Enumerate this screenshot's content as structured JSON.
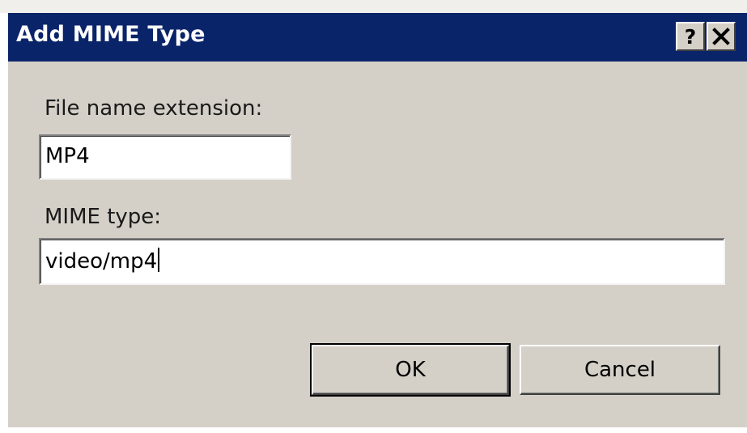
{
  "dialog": {
    "title": "Add MIME Type",
    "help_glyph": "?",
    "close_icon": "close-icon",
    "extension_label": "File name extension:",
    "extension_value": "MP4",
    "mime_label": "MIME type:",
    "mime_value": "video/mp4",
    "ok_label": "OK",
    "cancel_label": "Cancel"
  },
  "colors": {
    "title_bar": "#0a246a",
    "dialog_face": "#d4d0c8"
  }
}
